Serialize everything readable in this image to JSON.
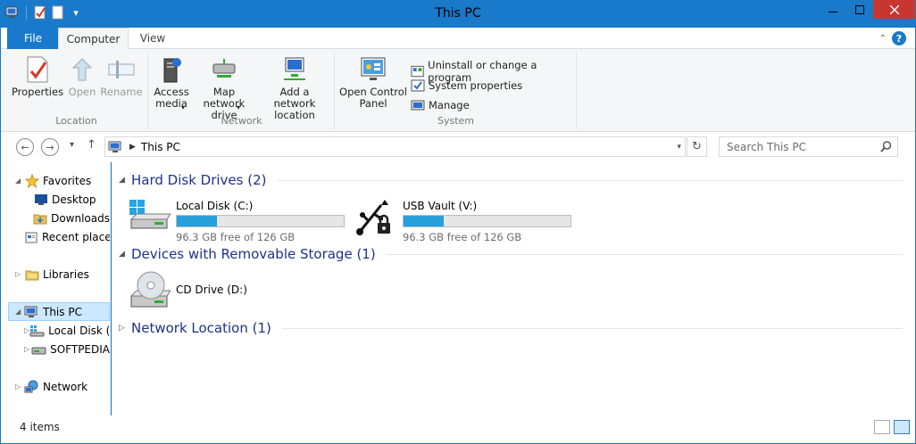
{
  "window": {
    "title": "This PC"
  },
  "ribbon": {
    "tabs": [
      {
        "label": "File"
      },
      {
        "label": "Computer"
      },
      {
        "label": "View"
      }
    ],
    "groups": [
      {
        "label": "Location",
        "buttons": [
          {
            "label": "Properties"
          },
          {
            "label": "Open"
          },
          {
            "label": "Rename"
          }
        ]
      },
      {
        "label": "Network",
        "buttons": [
          {
            "label": "Access media"
          },
          {
            "label": "Map network drive"
          },
          {
            "label": "Add a network location"
          }
        ]
      },
      {
        "label": "System",
        "big": {
          "label": "Open Control Panel"
        },
        "small": [
          {
            "label": "Uninstall or change a program"
          },
          {
            "label": "System properties"
          },
          {
            "label": "Manage"
          }
        ]
      }
    ]
  },
  "address": {
    "path": "This PC",
    "search_placeholder": "Search This PC"
  },
  "nav": {
    "items": [
      {
        "label": "Favorites"
      },
      {
        "label": "Desktop"
      },
      {
        "label": "Downloads"
      },
      {
        "label": "Recent places"
      },
      {
        "label": "Libraries"
      },
      {
        "label": "This PC"
      },
      {
        "label": "Local Disk (C:)"
      },
      {
        "label": "SOFTPEDIA"
      },
      {
        "label": "Network"
      }
    ]
  },
  "content": {
    "sections": [
      {
        "title": "Hard Disk Drives (2)"
      },
      {
        "title": "Devices with Removable Storage (1)"
      },
      {
        "title": "Network Location (1)"
      }
    ],
    "drives": [
      {
        "name": "Local Disk (C:)",
        "free": "96.3 GB free of 126 GB",
        "used_fraction": 0.24
      },
      {
        "name": "USB Vault (V:)",
        "free": "96.3 GB free of 126 GB",
        "used_fraction": 0.24
      },
      {
        "name": "CD Drive (D:)"
      }
    ]
  },
  "status": {
    "items": "4 items"
  },
  "colors": {
    "accent": "#1979ca",
    "selection": "#cce8ff",
    "section_heading": "#1e3287",
    "progress_fill": "#26a0da"
  },
  "icons": [
    "windows-explorer-icon",
    "properties-icon",
    "new-folder-icon",
    "dropdown-icon",
    "minimize-icon",
    "maximize-icon",
    "close-icon",
    "help-icon",
    "chevron-up-icon",
    "back-icon",
    "forward-icon",
    "up-icon",
    "refresh-icon",
    "search-icon",
    "star-icon",
    "desktop-icon",
    "downloads-icon",
    "recent-places-icon",
    "libraries-icon",
    "computer-icon",
    "hard-disk-icon",
    "usb-lock-icon",
    "cd-drive-icon",
    "network-icon",
    "details-view-icon",
    "large-icons-view-icon"
  ]
}
